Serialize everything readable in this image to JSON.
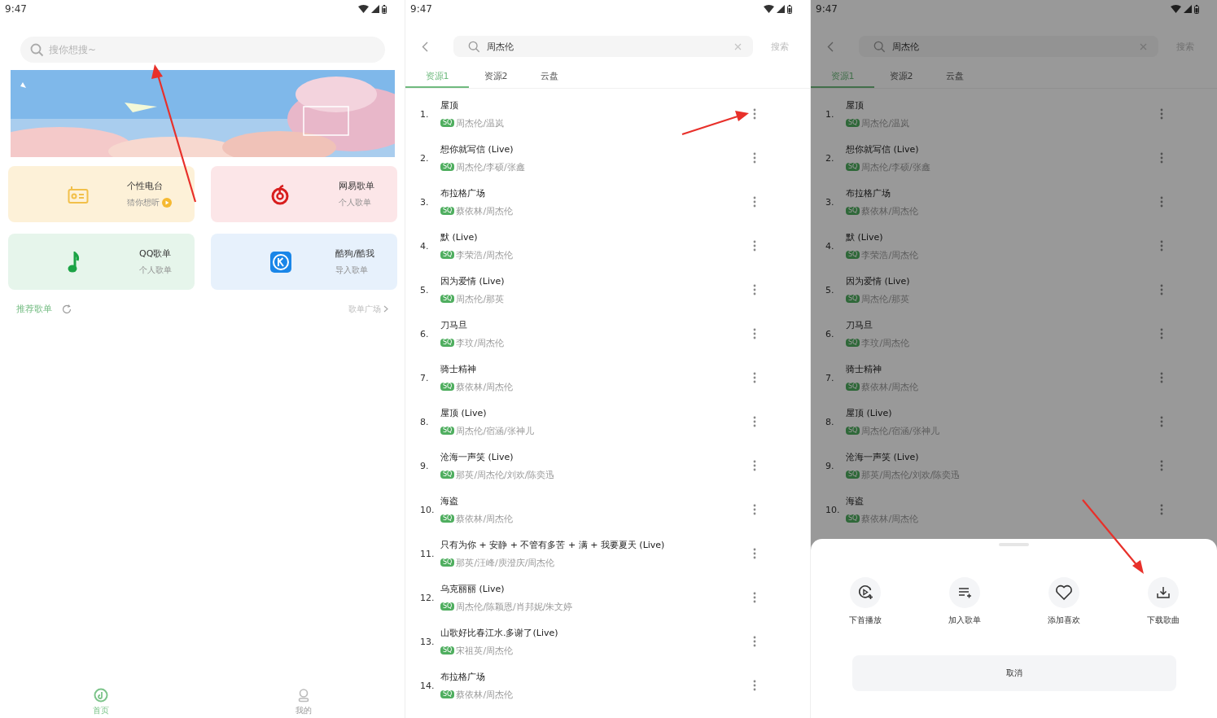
{
  "home_screen": {
    "status_bar": {
      "time": "9:47"
    },
    "search": {
      "placeholder": "搜你想搜~"
    },
    "cards": [
      {
        "title": "个性电台",
        "subtitle": "猜你想听",
        "kind": "radio",
        "color": "#fdf1d8",
        "play_badge": true
      },
      {
        "title": "网易歌单",
        "subtitle": "个人歌单",
        "kind": "netease",
        "color": "#fce6e8",
        "play_badge": false
      },
      {
        "title": "QQ歌单",
        "subtitle": "个人歌单",
        "kind": "qq",
        "color": "#e6f5eb",
        "play_badge": false
      },
      {
        "title": "酷狗/酷我",
        "subtitle": "导入歌单",
        "kind": "kugou",
        "color": "#e7f1fc",
        "play_badge": false
      }
    ],
    "section": {
      "title": "推荐歌单",
      "link": "歌单广场"
    },
    "nav": [
      {
        "label": "首页",
        "kind": "home",
        "selected": true
      },
      {
        "label": "我的",
        "kind": "mine",
        "selected": false
      }
    ]
  },
  "search_screen": {
    "status_bar": {
      "time": "9:47"
    },
    "search": {
      "value": "周杰伦",
      "button": "搜索"
    },
    "tabs": [
      {
        "label": "资源1",
        "selected": true
      },
      {
        "label": "资源2",
        "selected": false
      },
      {
        "label": "云盘",
        "selected": false
      }
    ],
    "songs": [
      {
        "number": "1.",
        "title": "屋顶",
        "badge": "SQ",
        "artists": "周杰伦/温岚"
      },
      {
        "number": "2.",
        "title": "想你就写信 (Live)",
        "badge": "SQ",
        "artists": "周杰伦/李硕/张鑫"
      },
      {
        "number": "3.",
        "title": "布拉格广场",
        "badge": "SQ",
        "artists": "蔡依林/周杰伦"
      },
      {
        "number": "4.",
        "title": "默 (Live)",
        "badge": "SQ",
        "artists": "李荣浩/周杰伦"
      },
      {
        "number": "5.",
        "title": "因为爱情 (Live)",
        "badge": "SQ",
        "artists": "周杰伦/那英"
      },
      {
        "number": "6.",
        "title": "刀马旦",
        "badge": "SQ",
        "artists": "李玟/周杰伦"
      },
      {
        "number": "7.",
        "title": "骑士精神",
        "badge": "SQ",
        "artists": "蔡依林/周杰伦"
      },
      {
        "number": "8.",
        "title": "屋顶 (Live)",
        "badge": "SQ",
        "artists": "周杰伦/宿涵/张神儿"
      },
      {
        "number": "9.",
        "title": "沧海一声笑 (Live)",
        "badge": "SQ",
        "artists": "那英/周杰伦/刘欢/陈奕迅"
      },
      {
        "number": "10.",
        "title": "海盗",
        "badge": "SQ",
        "artists": "蔡依林/周杰伦"
      },
      {
        "number": "11.",
        "title": "只有为你 + 安静 + 不管有多苦 + 满 + 我要夏天 (Live)",
        "badge": "SQ",
        "artists": "那英/汪峰/庾澄庆/周杰伦"
      },
      {
        "number": "12.",
        "title": "乌克丽丽 (Live)",
        "badge": "SQ",
        "artists": "周杰伦/陈颖恩/肖邦妮/朱文婷"
      },
      {
        "number": "13.",
        "title": "山歌好比春江水.多谢了(Live)",
        "badge": "SQ",
        "artists": "宋祖英/周杰伦"
      },
      {
        "number": "14.",
        "title": "布拉格广场",
        "badge": "SQ",
        "artists": "蔡依林/周杰伦"
      }
    ]
  },
  "menu_screen": {
    "status_bar": {
      "time": "9:47"
    },
    "search": {
      "value": "周杰伦",
      "button": "搜索"
    },
    "tabs": [
      {
        "label": "资源1",
        "selected": true
      },
      {
        "label": "资源2",
        "selected": false
      },
      {
        "label": "云盘",
        "selected": false
      }
    ],
    "songs": [
      {
        "number": "1.",
        "title": "屋顶",
        "badge": "SQ",
        "artists": "周杰伦/温岚"
      },
      {
        "number": "2.",
        "title": "想你就写信 (Live)",
        "badge": "SQ",
        "artists": "周杰伦/李硕/张鑫"
      },
      {
        "number": "3.",
        "title": "布拉格广场",
        "badge": "SQ",
        "artists": "蔡依林/周杰伦"
      },
      {
        "number": "4.",
        "title": "默 (Live)",
        "badge": "SQ",
        "artists": "李荣浩/周杰伦"
      },
      {
        "number": "5.",
        "title": "因为爱情 (Live)",
        "badge": "SQ",
        "artists": "周杰伦/那英"
      },
      {
        "number": "6.",
        "title": "刀马旦",
        "badge": "SQ",
        "artists": "李玟/周杰伦"
      },
      {
        "number": "7.",
        "title": "骑士精神",
        "badge": "SQ",
        "artists": "蔡依林/周杰伦"
      },
      {
        "number": "8.",
        "title": "屋顶 (Live)",
        "badge": "SQ",
        "artists": "周杰伦/宿涵/张神儿"
      },
      {
        "number": "9.",
        "title": "沧海一声笑 (Live)",
        "badge": "SQ",
        "artists": "那英/周杰伦/刘欢/陈奕迅"
      },
      {
        "number": "10.",
        "title": "海盗",
        "badge": "SQ",
        "artists": "蔡依林/周杰伦"
      }
    ],
    "action_sheet": {
      "actions": [
        {
          "label": "下首播放",
          "kind": "play_next"
        },
        {
          "label": "加入歌单",
          "kind": "add_playlist"
        },
        {
          "label": "添加喜欢",
          "kind": "like"
        },
        {
          "label": "下载歌曲",
          "kind": "download"
        }
      ],
      "cancel": "取消"
    }
  }
}
